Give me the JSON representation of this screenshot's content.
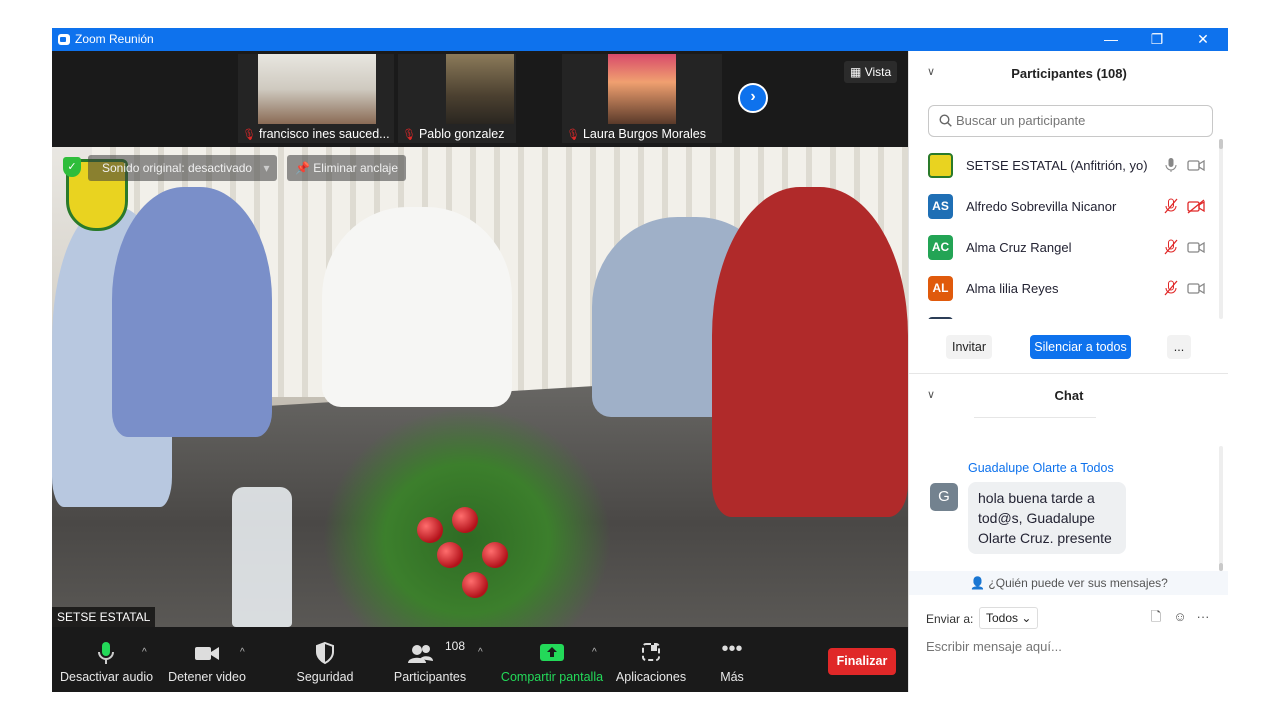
{
  "window": {
    "title": "Zoom Reunión",
    "controls": [
      "—",
      "❐",
      "✕"
    ]
  },
  "thumbnails": [
    {
      "name": "francisco ines sauced..."
    },
    {
      "name": "Pablo gonzalez"
    },
    {
      "name": "Laura Burgos Morales"
    }
  ],
  "view": {
    "label": "Vista"
  },
  "main_video": {
    "original_sound": "Sonido original: desactivado",
    "unpin": "Eliminar anclaje",
    "speaker_name": "SETSE ESTATAL"
  },
  "toolbar": {
    "mute_audio": "Desactivar audio",
    "stop_video": "Detener video",
    "security": "Seguridad",
    "participants": "Participantes",
    "participants_count": "108",
    "share_screen": "Compartir pantalla",
    "apps": "Aplicaciones",
    "more": "Más",
    "end": "Finalizar"
  },
  "participants_panel": {
    "title": "Participantes (108)",
    "search_placeholder": "Buscar un participante",
    "participants": [
      {
        "initials": "",
        "name": "SETSE ESTATAL (Anfitrión, yo)",
        "color": "#e9d320",
        "mic": "on",
        "video": "on"
      },
      {
        "initials": "AS",
        "name": "Alfredo Sobrevilla Nicanor",
        "color": "#1f6fb5",
        "mic": "off",
        "video": "off"
      },
      {
        "initials": "AC",
        "name": "Alma Cruz Rangel",
        "color": "#23a455",
        "mic": "off",
        "video": "on"
      },
      {
        "initials": "AL",
        "name": "Alma lilia Reyes",
        "color": "#e05a0c",
        "mic": "off",
        "video": "on"
      }
    ],
    "invite": "Invitar",
    "mute_all": "Silenciar a todos",
    "more": "..."
  },
  "chat": {
    "title": "Chat",
    "messages": [
      {
        "sender": "Guadalupe Olarte a Todos",
        "initial": "G",
        "text": "hola buena tarde a tod@s, Guadalupe Olarte Cruz. presente"
      }
    ],
    "who_can_see": "¿Quién puede ver sus mensajes?",
    "send_to_label": "Enviar a:",
    "send_to_value": "Todos",
    "more": "···",
    "input_placeholder": "Escribir mensaje aquí..."
  },
  "colors": {
    "zoom_blue": "#0e72ed",
    "end_red": "#e02828",
    "share_green": "#23d959",
    "mic_off_red": "#e02828"
  }
}
